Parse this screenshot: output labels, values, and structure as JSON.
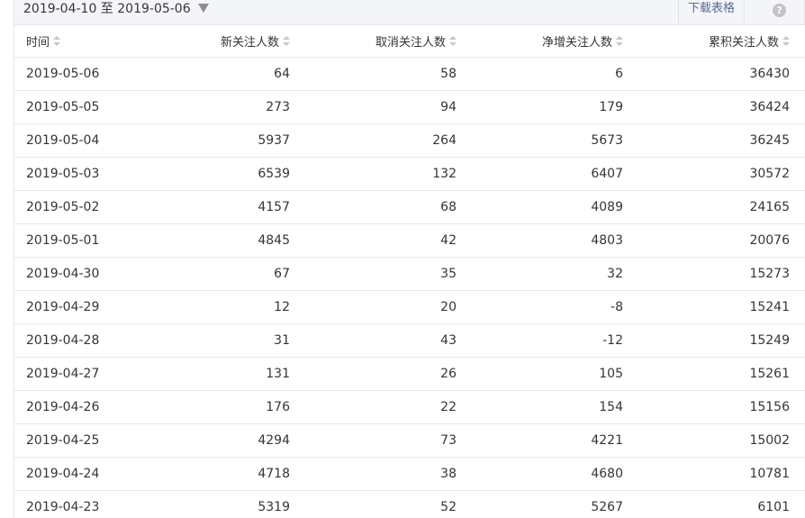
{
  "toolbar": {
    "date_range": "2019-04-10 至 2019-05-06",
    "download_label": "下载表格",
    "help_glyph": "?"
  },
  "table": {
    "columns": [
      "时间",
      "新关注人数",
      "取消关注人数",
      "净增关注人数",
      "累积关注人数"
    ],
    "rows": [
      [
        "2019-05-06",
        "64",
        "58",
        "6",
        "36430"
      ],
      [
        "2019-05-05",
        "273",
        "94",
        "179",
        "36424"
      ],
      [
        "2019-05-04",
        "5937",
        "264",
        "5673",
        "36245"
      ],
      [
        "2019-05-03",
        "6539",
        "132",
        "6407",
        "30572"
      ],
      [
        "2019-05-02",
        "4157",
        "68",
        "4089",
        "24165"
      ],
      [
        "2019-05-01",
        "4845",
        "42",
        "4803",
        "20076"
      ],
      [
        "2019-04-30",
        "67",
        "35",
        "32",
        "15273"
      ],
      [
        "2019-04-29",
        "12",
        "20",
        "-8",
        "15241"
      ],
      [
        "2019-04-28",
        "31",
        "43",
        "-12",
        "15249"
      ],
      [
        "2019-04-27",
        "131",
        "26",
        "105",
        "15261"
      ],
      [
        "2019-04-26",
        "176",
        "22",
        "154",
        "15156"
      ],
      [
        "2019-04-25",
        "4294",
        "73",
        "4221",
        "15002"
      ],
      [
        "2019-04-24",
        "4718",
        "38",
        "4680",
        "10781"
      ],
      [
        "2019-04-23",
        "5319",
        "52",
        "5267",
        "6101"
      ]
    ]
  }
}
